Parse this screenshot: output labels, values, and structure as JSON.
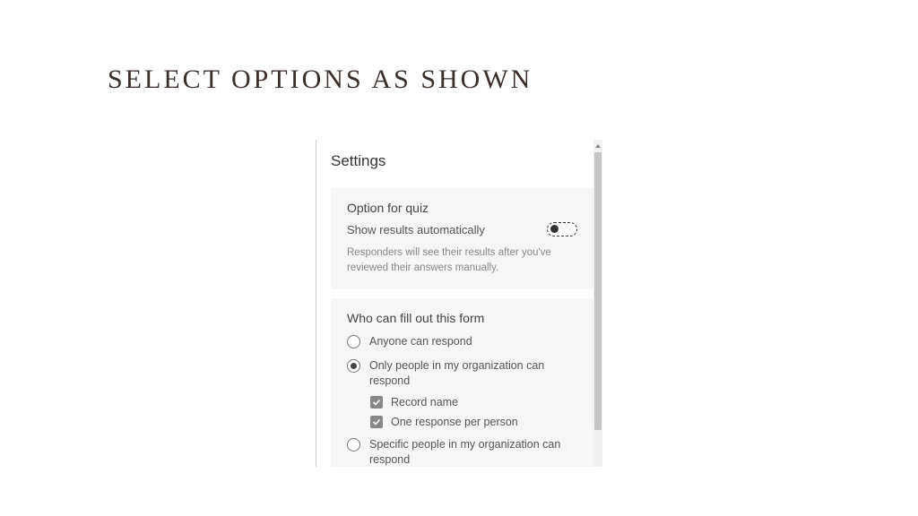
{
  "slide": {
    "title": "SELECT OPTIONS AS SHOWN"
  },
  "settings": {
    "panel_title": "Settings",
    "quiz_section": {
      "title": "Option for quiz",
      "toggle_label": "Show results automatically",
      "toggle_on": false,
      "helper": "Responders will see their results after you've reviewed their answers manually."
    },
    "fill_section": {
      "title": "Who can fill out this form",
      "options": [
        {
          "label": "Anyone can respond",
          "selected": false
        },
        {
          "label": "Only people in my organization can respond",
          "selected": true
        },
        {
          "label": "Specific people in my organization can respond",
          "selected": false
        }
      ],
      "sub_checks": [
        {
          "label": "Record name",
          "checked": true
        },
        {
          "label": "One response per person",
          "checked": true
        }
      ]
    }
  }
}
